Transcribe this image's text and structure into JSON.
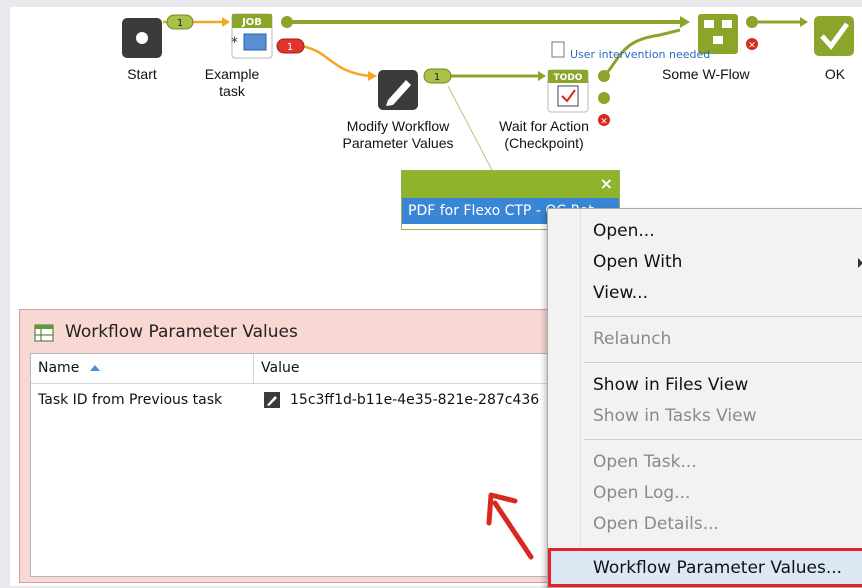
{
  "workflow": {
    "nodes": {
      "start": {
        "label": "Start"
      },
      "example_task": {
        "label_line1": "Example",
        "label_line2": "task",
        "badge": "JOB"
      },
      "modify": {
        "label_line1": "Modify Workflow",
        "label_line2": "Parameter Values"
      },
      "wait": {
        "label_line1": "Wait for Action",
        "label_line2": "(Checkpoint)",
        "badge": "TODO"
      },
      "some_wflow": {
        "label": "Some W-Flow"
      },
      "ok": {
        "label": "OK"
      }
    },
    "connector_counts": {
      "start_to_job": "1",
      "job_error": "1",
      "modify_to_wait": "1"
    },
    "note": "User intervention needed",
    "popup": {
      "close": "×",
      "item": "PDF for Flexo CTP - OC Rot"
    }
  },
  "panel": {
    "title": "Workflow Parameter Values",
    "columns": {
      "name": "Name",
      "value": "Value"
    },
    "rows": [
      {
        "name": "Task ID from Previous task",
        "value": "15c3ff1d-b11e-4e35-821e-287c436"
      }
    ]
  },
  "context_menu": {
    "items": [
      {
        "label": "Open...",
        "enabled": true
      },
      {
        "label": "Open With",
        "enabled": true
      },
      {
        "label": "View...",
        "enabled": true
      },
      {
        "label": "Relaunch",
        "enabled": false
      },
      {
        "label": "Show in Files View",
        "enabled": true
      },
      {
        "label": "Show in Tasks View",
        "enabled": false
      },
      {
        "label": "Open Task...",
        "enabled": false
      },
      {
        "label": "Open Log...",
        "enabled": false
      },
      {
        "label": "Open Details...",
        "enabled": false
      },
      {
        "label": "Workflow Parameter Values...",
        "enabled": true
      }
    ]
  },
  "colors": {
    "flow_green": "#8aa52a",
    "flow_orange": "#f5a623",
    "error_red": "#d9281f",
    "highlight_red": "#e0262a"
  }
}
